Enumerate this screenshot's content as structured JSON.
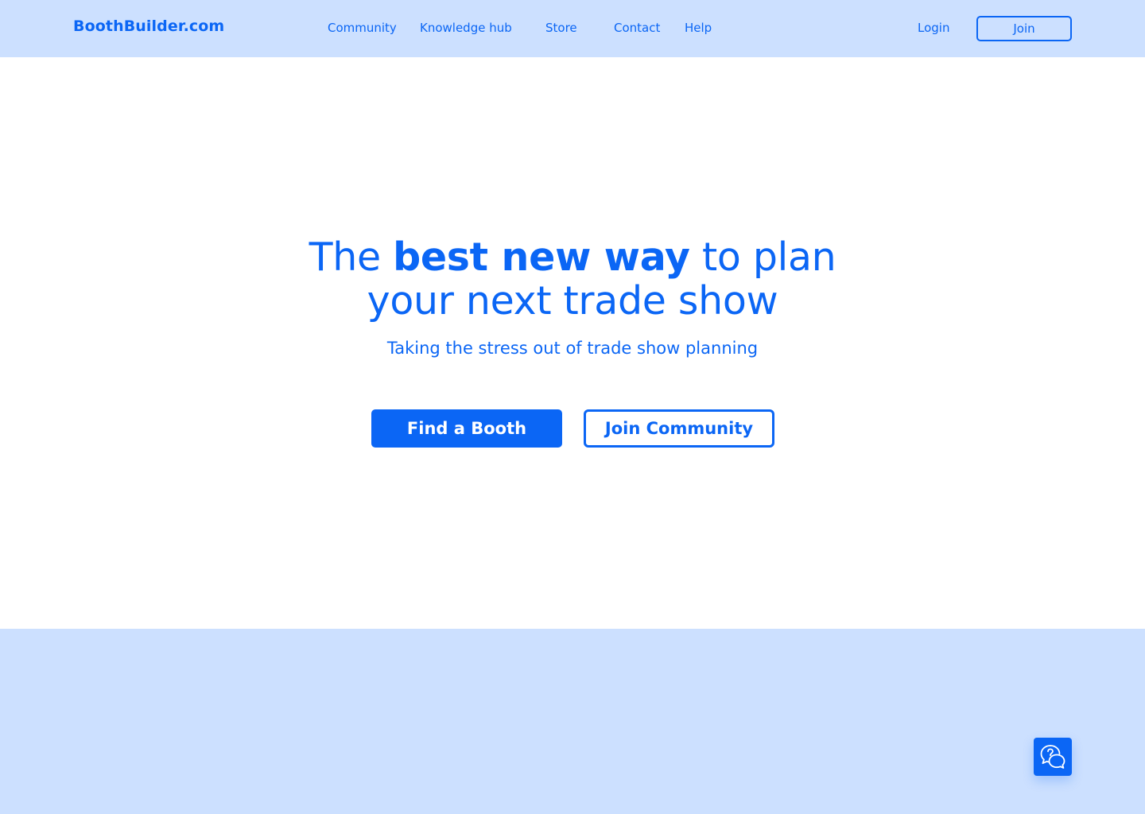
{
  "header": {
    "logo": "BoothBuilder.com",
    "nav": {
      "community": "Community",
      "knowledge_hub": "Knowledge hub",
      "store": "Store",
      "contact": "Contact",
      "help": "Help"
    },
    "login_label": "Login",
    "join_label": "Join"
  },
  "hero": {
    "title_prefix": "The",
    "title_bold": "best new way",
    "title_suffix": "to plan",
    "title_line2": "your next trade show",
    "subtitle": "Taking the stress out of trade show planning",
    "primary_button": "Find a Booth",
    "secondary_button": "Join Community"
  },
  "widgets": {
    "help_chat_icon": "help-chat-icon"
  },
  "colors": {
    "accent": "#0b66f5",
    "header_background": "#cce0ff",
    "page_background": "#ffffff"
  }
}
